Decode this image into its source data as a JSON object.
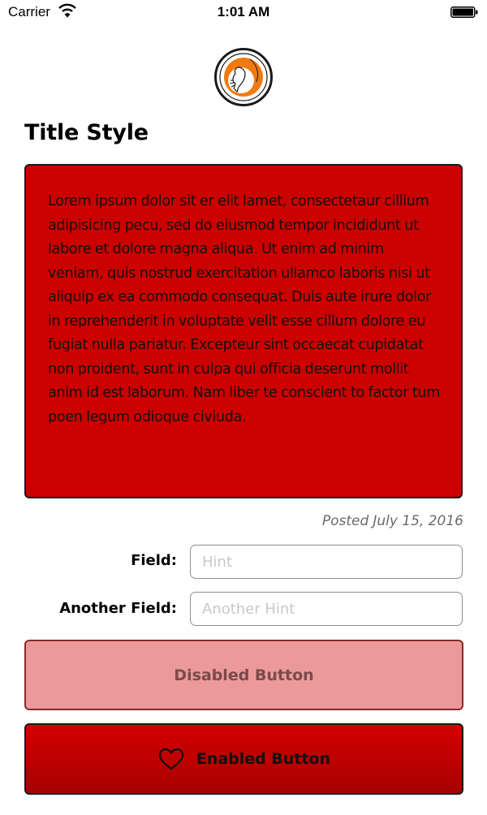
{
  "status_bar": {
    "carrier": "Carrier",
    "time": "1:01 AM",
    "wifi_icon": "wifi-icon",
    "battery_icon": "battery-icon"
  },
  "logo": {
    "icon": "logo-icon",
    "accent_color": "#f07a10"
  },
  "title": "Title Style",
  "content": {
    "background_color": "#cc0000",
    "text": "Lorem ipsum dolor sit er elit lamet, consectetaur cillium adipisicing pecu, sed do eiusmod tempor incididunt ut labore et dolore magna aliqua. Ut enim ad minim veniam, quis nostrud exercitation ullamco laboris nisi ut aliquip ex ea commodo consequat. Duis aute irure dolor in reprehenderit in voluptate velit esse cillum dolore eu fugiat nulla pariatur. Excepteur sint occaecat cupidatat non proident, sunt in culpa qui officia deserunt mollit anim id est laborum. Nam liber te conscient to factor tum poen legum odioque civiuda."
  },
  "posted": {
    "label": "Posted",
    "date": "July 15, 2016"
  },
  "form": {
    "field": {
      "label": "Field:",
      "value": "",
      "placeholder": "Hint"
    },
    "another_field": {
      "label": "Another Field:",
      "value": "",
      "placeholder": "Another Hint"
    }
  },
  "buttons": {
    "disabled": {
      "label": "Disabled Button",
      "color": "#eb9999"
    },
    "enabled": {
      "label": "Enabled Button",
      "icon": "heart-icon",
      "color": "#cc0000"
    }
  }
}
